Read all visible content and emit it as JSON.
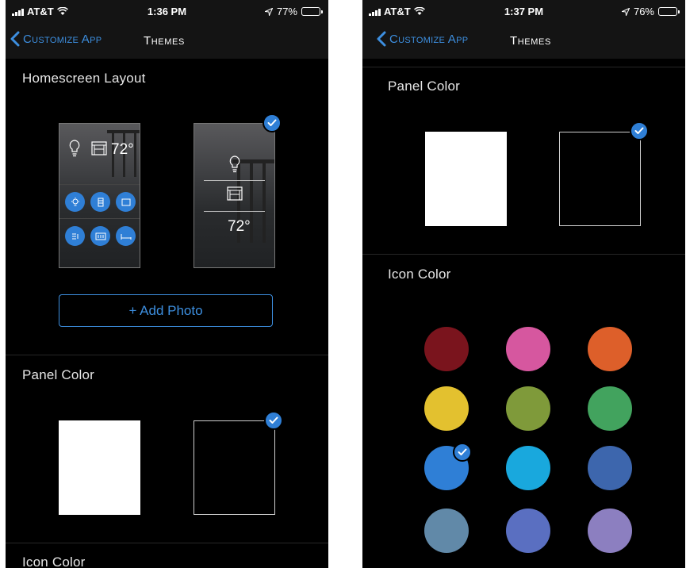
{
  "screens": [
    {
      "status": {
        "carrier": "AT&T",
        "time": "1:36 PM",
        "battery": "77%",
        "battery_level": 0.77
      },
      "nav": {
        "back_label": "Customize App",
        "title": "Themes"
      },
      "homescreen": {
        "title": "Homescreen Layout",
        "layout1_temp": "72°",
        "layout2_temp": "72°",
        "selected": "layout-2"
      },
      "add_photo": "+ Add Photo",
      "panel_color": {
        "title": "Panel Color",
        "selected": "black"
      },
      "icon_color": {
        "title": "Icon Color"
      }
    },
    {
      "status": {
        "carrier": "AT&T",
        "time": "1:37 PM",
        "battery": "76%",
        "battery_level": 0.76
      },
      "nav": {
        "back_label": "Customize App",
        "title": "Themes"
      },
      "panel_color": {
        "title": "Panel Color",
        "selected": "black"
      },
      "icon_color": {
        "title": "Icon Color",
        "swatches": [
          "#7a141d",
          "#d6579f",
          "#dd5f2a",
          "#e3c12f",
          "#7f9a3a",
          "#42a35e",
          "#2f7fd6",
          "#19a8dd",
          "#3d66ad",
          "#6189a8",
          "#5a6fc1",
          "#8c7fc0"
        ],
        "selected_index": 6
      }
    }
  ],
  "colors": {
    "accent": "#3d8fe0",
    "check": "#2f7fd6",
    "background": "#000000",
    "bar": "#141414"
  }
}
